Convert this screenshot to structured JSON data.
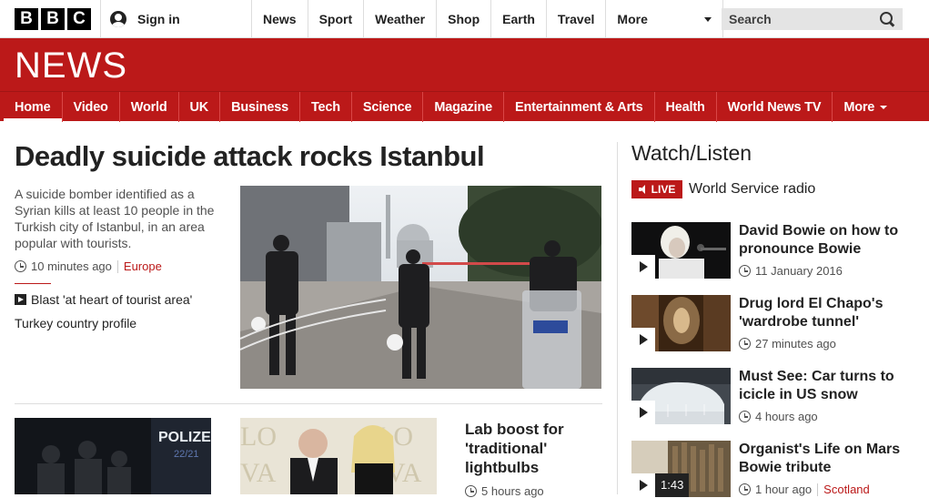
{
  "brand": {
    "b1": "B",
    "b2": "B",
    "b3": "C",
    "section": "NEWS"
  },
  "account": {
    "signin": "Sign in"
  },
  "topnav": {
    "items": [
      "News",
      "Sport",
      "Weather",
      "Shop",
      "Earth",
      "Travel"
    ],
    "more": "More"
  },
  "search": {
    "label": "Search"
  },
  "secnav": {
    "items": [
      "Home",
      "Video",
      "World",
      "UK",
      "Business",
      "Tech",
      "Science",
      "Magazine",
      "Entertainment & Arts",
      "Health",
      "World News TV"
    ],
    "more": "More",
    "active": "Home"
  },
  "lead": {
    "headline": "Deadly suicide attack rocks Istanbul",
    "summary": "A suicide bomber identified as a Syrian kills at least 10 people in the Turkish city of Istanbul, in an area popular with tourists.",
    "time": "10 minutes ago",
    "tag": "Europe",
    "related": [
      "Blast 'at heart of tourist area'",
      "Turkey country profile"
    ]
  },
  "stories": [
    {
      "title": "Lab boost for 'traditional' lightbulbs",
      "time": "5 hours ago"
    }
  ],
  "watch_listen": {
    "title": "Watch/Listen",
    "live_badge": "LIVE",
    "live_text": "World Service radio",
    "items": [
      {
        "headline": "David Bowie on how to pronounce Bowie",
        "time": "11 January 2016",
        "tag": "",
        "duration": ""
      },
      {
        "headline": "Drug lord El Chapo's 'wardrobe tunnel'",
        "time": "27 minutes ago",
        "tag": "",
        "duration": ""
      },
      {
        "headline": "Must See: Car turns to icicle in US snow",
        "time": "4 hours ago",
        "tag": "",
        "duration": ""
      },
      {
        "headline": "Organist's Life on Mars Bowie tribute",
        "time": "1 hour ago",
        "tag": "Scotland",
        "duration": "1:43"
      }
    ]
  },
  "colors": {
    "brand_red": "#bb1919",
    "text": "#222222",
    "meta": "#505050"
  }
}
